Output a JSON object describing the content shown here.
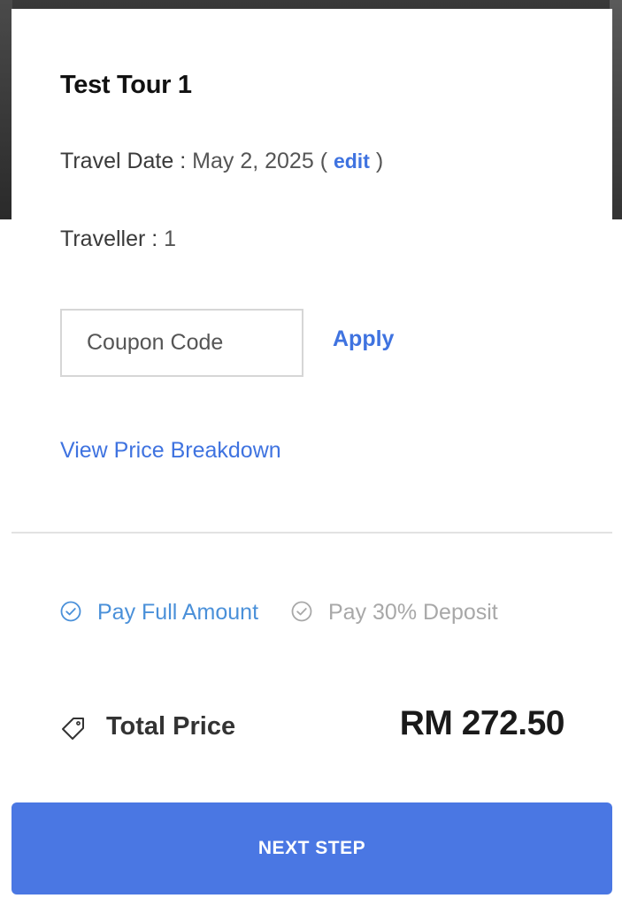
{
  "tour": {
    "title": "Test Tour 1"
  },
  "travel_date": {
    "label": "Travel Date :",
    "value": "May 2, 2025",
    "open_paren": "(",
    "edit_label": "edit",
    "close_paren": ")"
  },
  "traveller": {
    "label": "Traveller :",
    "count": "1"
  },
  "coupon": {
    "placeholder": "Coupon Code",
    "value": "",
    "apply_label": "Apply"
  },
  "price_breakdown": {
    "link_label": "View Price Breakdown"
  },
  "payment_options": {
    "full_label": "Pay Full Amount",
    "deposit_label": "Pay 30% Deposit",
    "selected": "full",
    "icons": {
      "full": "check-circle-icon",
      "deposit": "check-circle-icon"
    }
  },
  "total": {
    "label": "Total Price",
    "value": "RM 272.50",
    "icon": "price-tag-icon"
  },
  "actions": {
    "next_label": "NEXT STEP"
  },
  "colors": {
    "accent": "#4a77e3",
    "link": "#3f73e0",
    "selected_option": "#4a90d9",
    "unselected_option": "#a8a8a8"
  }
}
